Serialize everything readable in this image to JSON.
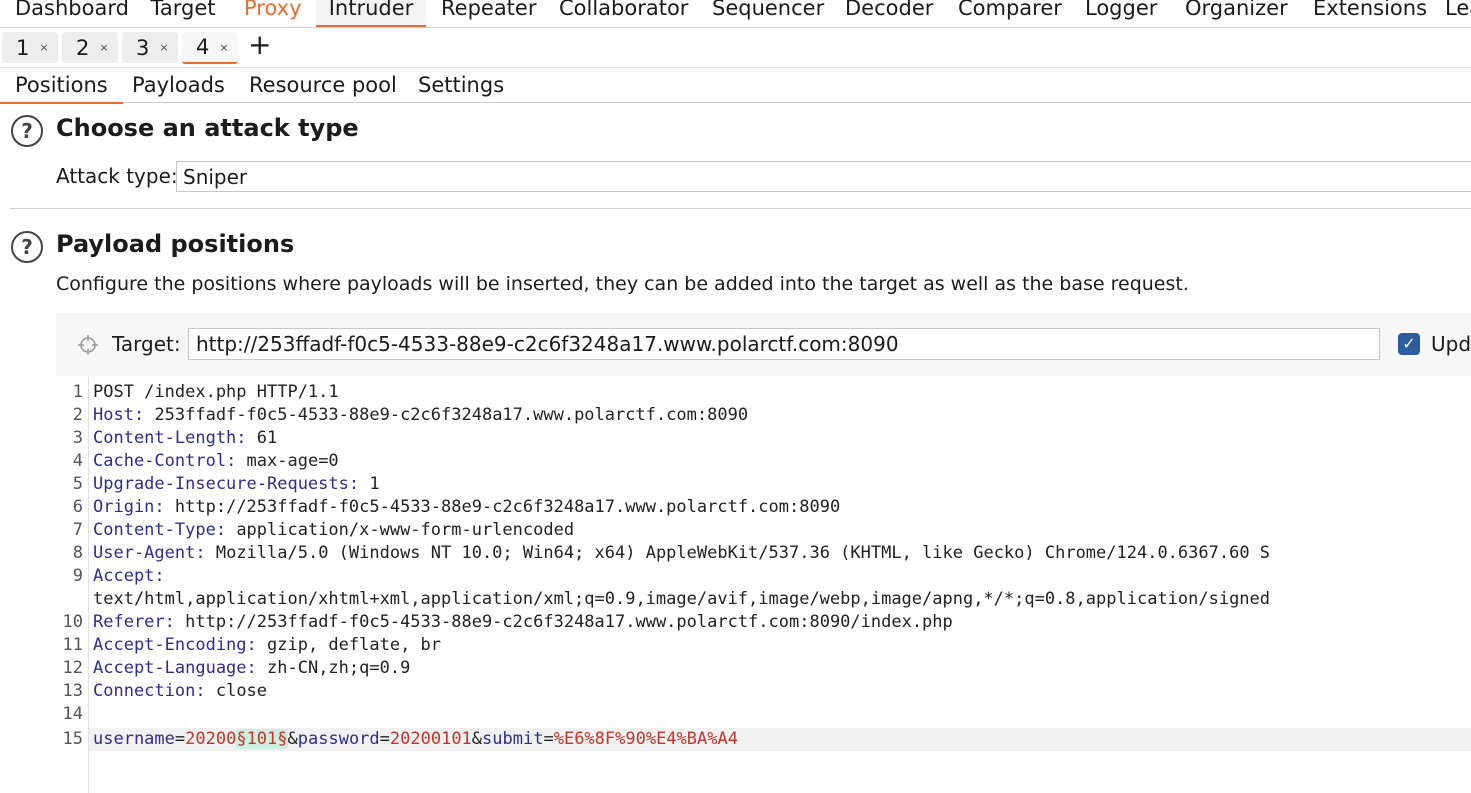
{
  "top_tabs": [
    "Dashboard",
    "Target",
    "Proxy",
    "Intruder",
    "Repeater",
    "Collaborator",
    "Sequencer",
    "Decoder",
    "Comparer",
    "Logger",
    "Organizer",
    "Extensions",
    "Lea"
  ],
  "request_tabs": [
    {
      "label": "1",
      "close": "×"
    },
    {
      "label": "2",
      "close": "×"
    },
    {
      "label": "3",
      "close": "×"
    },
    {
      "label": "4",
      "close": "×"
    }
  ],
  "add_tab": "+",
  "sub_tabs": [
    "Positions",
    "Payloads",
    "Resource pool",
    "Settings"
  ],
  "attack": {
    "title": "Choose an attack type",
    "label": "Attack type:",
    "value": "Sniper"
  },
  "payload": {
    "title": "Payload positions",
    "description": "Configure the positions where payloads will be inserted, they can be added into the target as well as the base request.",
    "target_label": "Target:",
    "target_value": "http://253ffadf-f0c5-4533-88e9-c2c6f3248a17.www.polarctf.com:8090",
    "checkbox_label": "Upd"
  },
  "help_icon": "?",
  "request_lines": [
    {
      "n": "1",
      "text": "POST /index.php HTTP/1.1"
    },
    {
      "n": "2",
      "key": "Host",
      "val": " 253ffadf-f0c5-4533-88e9-c2c6f3248a17.www.polarctf.com:8090"
    },
    {
      "n": "3",
      "key": "Content-Length",
      "val": " 61"
    },
    {
      "n": "4",
      "key": "Cache-Control",
      "val": " max-age=0"
    },
    {
      "n": "5",
      "key": "Upgrade-Insecure-Requests",
      "val": " 1"
    },
    {
      "n": "6",
      "key": "Origin",
      "val": " http://253ffadf-f0c5-4533-88e9-c2c6f3248a17.www.polarctf.com:8090"
    },
    {
      "n": "7",
      "key": "Content-Type",
      "val": " application/x-www-form-urlencoded"
    },
    {
      "n": "8",
      "key": "User-Agent",
      "val": " Mozilla/5.0 (Windows NT 10.0; Win64; x64) AppleWebKit/537.36 (KHTML, like Gecko) Chrome/124.0.6367.60 S"
    },
    {
      "n": "9",
      "key": "Accept",
      "val": ""
    },
    {
      "n": "",
      "text": "text/html,application/xhtml+xml,application/xml;q=0.9,image/avif,image/webp,image/apng,*/*;q=0.8,application/signed"
    },
    {
      "n": "10",
      "key": "Referer",
      "val": " http://253ffadf-f0c5-4533-88e9-c2c6f3248a17.www.polarctf.com:8090/index.php"
    },
    {
      "n": "11",
      "key": "Accept-Encoding",
      "val": " gzip, deflate, br"
    },
    {
      "n": "12",
      "key": "Accept-Language",
      "val": " zh-CN,zh;q=0.9"
    },
    {
      "n": "13",
      "key": "Connection",
      "val": " close"
    },
    {
      "n": "14",
      "text": ""
    }
  ],
  "body_line": {
    "n": "15",
    "p1": "username",
    "eq1": "=",
    "v1": "20200",
    "marker": "§101§",
    "amp1": "&",
    "p2": "password",
    "eq2": "=",
    "v2": "20200101",
    "amp2": "&",
    "p3": "submit",
    "eq3": "=",
    "v3": "%E6%8F%90%E4%BA%A4"
  },
  "colors": {
    "accent": "#ee6b2f",
    "header_key": "#2a2f8f",
    "param_value": "#c2352b",
    "marker_bg": "#cdeee0",
    "checkbox": "#2c5d9c"
  }
}
